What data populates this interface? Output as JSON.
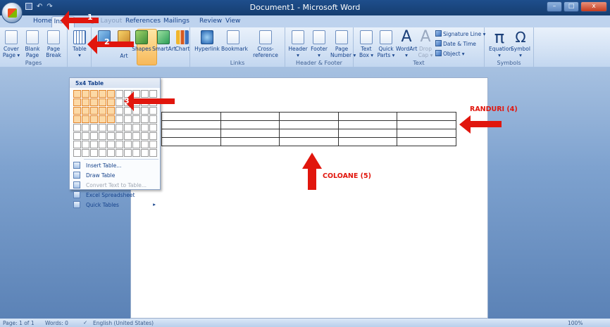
{
  "window": {
    "title": "Document1 - Microsoft Word",
    "minimize": "–",
    "maximize": "□",
    "close": "x"
  },
  "tabs": [
    "Home",
    "Insert",
    "Page Layout",
    "References",
    "Mailings",
    "Review",
    "View"
  ],
  "ribbon": {
    "pages": {
      "label": "Pages",
      "cover": "Cover\nPage ▾",
      "blank": "Blank\nPage",
      "break": "Page\nBreak"
    },
    "tables": {
      "table": "Table\n▾"
    },
    "illustrations": {
      "art": "Art",
      "shapes": "Shapes",
      "smartart": "SmartArt",
      "chart": "Chart"
    },
    "links": {
      "label": "Links",
      "hyperlink": "Hyperlink",
      "bookmark": "Bookmark",
      "cross": "Cross-reference"
    },
    "header_footer": {
      "label": "Header & Footer",
      "header": "Header\n▾",
      "footer": "Footer\n▾",
      "page_number": "Page\nNumber ▾"
    },
    "text": {
      "label": "Text",
      "textbox": "Text\nBox ▾",
      "quickparts": "Quick\nParts ▾",
      "wordart": "WordArt\n▾",
      "dropcap": "Drop\nCap ▾",
      "signature": "Signature Line ▾",
      "datetime": "Date & Time",
      "object": "Object ▾"
    },
    "symbols": {
      "label": "Symbols",
      "equation": "Equation\n▾",
      "symbol": "Symbol\n▾",
      "pi": "π",
      "omega": "Ω"
    }
  },
  "dropdown": {
    "title": "5x4 Table",
    "grid_cols": 10,
    "grid_rows": 8,
    "selected_cols": 5,
    "selected_rows": 4,
    "items": [
      {
        "label": "Insert Table...",
        "enabled": true,
        "icon": "insert-table-icon"
      },
      {
        "label": "Draw Table",
        "enabled": true,
        "icon": "draw-table-icon"
      },
      {
        "label": "Convert Text to Table...",
        "enabled": false,
        "icon": "convert-text-icon"
      },
      {
        "label": "Excel Spreadsheet",
        "enabled": true,
        "icon": "excel-icon"
      },
      {
        "label": "Quick Tables",
        "enabled": true,
        "icon": "quick-tables-icon",
        "submenu": "▸"
      }
    ]
  },
  "document": {
    "table_rows": 4,
    "table_cols": 5
  },
  "annotations": {
    "step1": "1",
    "step2": "2",
    "step3": "3",
    "rows_label": "RANDURI (4)",
    "cols_label": "COLOANE (5)",
    "arrow_color": "#e1160d"
  },
  "status": {
    "page": "Page: 1 of 1",
    "words": "Words: 0",
    "language": "English (United States)",
    "zoom": "100%"
  }
}
